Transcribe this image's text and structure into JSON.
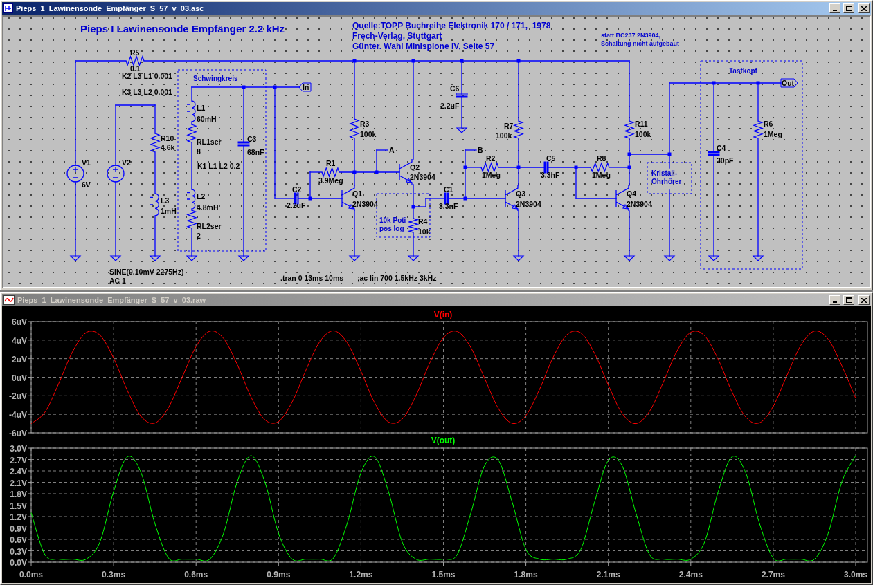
{
  "schematic_window": {
    "title": "Pieps_1_Lawinensonde_Empfänger_S_57_v_03.asc",
    "active": true
  },
  "schematic": {
    "heading": "Pieps I Lawinensonde Empfänger 2.2 kHz",
    "source_lines": [
      "Quelle:TOPP Buchreihe Elektronik 170 / 171,  1978",
      "Frech-Verlag, Stuttgart",
      "Günter. Wahl Minispione IV, Seite 57"
    ],
    "notes": [
      {
        "lines": [
          "statt BC237 2N3904,",
          "Schaltung nicht aufgebaut"
        ]
      },
      {
        "lines": [
          "Schwingkreis"
        ]
      },
      {
        "lines": [
          "10k Poti",
          "pos log"
        ]
      },
      {
        "lines": [
          "Kristall-",
          "Ohrhörer"
        ]
      },
      {
        "lines": [
          "Tastkopf"
        ]
      }
    ],
    "components": [
      {
        "kind": "resistor",
        "name": "R5",
        "value": "0.1"
      },
      {
        "kind": "source",
        "name": "V1",
        "value": "6V"
      },
      {
        "kind": "source",
        "name": "V2",
        "value": "SINE(0.10mV 2275Hz)",
        "extra": "AC 1"
      },
      {
        "kind": "resistor",
        "name": "R10",
        "value": "4.6k"
      },
      {
        "kind": "inductor",
        "name": "L3",
        "value": "1mH"
      },
      {
        "kind": "inductor",
        "name": "L1",
        "value": "60mH"
      },
      {
        "kind": "resistor",
        "name": "RL1ser",
        "value": "8"
      },
      {
        "kind": "inductor",
        "name": "L2",
        "value": "4.8mH"
      },
      {
        "kind": "resistor",
        "name": "RL2ser",
        "value": "2"
      },
      {
        "kind": "capacitor",
        "name": "C3",
        "value": "68nF"
      },
      {
        "kind": "polar_capacitor",
        "name": "C2",
        "value": "2.2uF"
      },
      {
        "kind": "resistor",
        "name": "R1",
        "value": "3.9Meg"
      },
      {
        "kind": "resistor",
        "name": "R3",
        "value": "100k"
      },
      {
        "kind": "npn",
        "name": "Q1",
        "value": "2N3904"
      },
      {
        "kind": "npn",
        "name": "Q2",
        "value": "2N3904"
      },
      {
        "kind": "resistor",
        "name": "R4",
        "value": "10k"
      },
      {
        "kind": "polar_capacitor",
        "name": "C6",
        "value": "2.2uF"
      },
      {
        "kind": "capacitor",
        "name": "C1",
        "value": "3.3nF"
      },
      {
        "kind": "resistor",
        "name": "R2",
        "value": "1Meg"
      },
      {
        "kind": "resistor",
        "name": "R7",
        "value": "100k"
      },
      {
        "kind": "npn",
        "name": "Q3",
        "value": "2N3904"
      },
      {
        "kind": "capacitor",
        "name": "C5",
        "value": "3.3nF"
      },
      {
        "kind": "resistor",
        "name": "R8",
        "value": "1Meg"
      },
      {
        "kind": "resistor",
        "name": "R11",
        "value": "100k"
      },
      {
        "kind": "npn",
        "name": "Q4",
        "value": "2N3904"
      },
      {
        "kind": "capacitor",
        "name": "C4",
        "value": "30pF"
      },
      {
        "kind": "resistor",
        "name": "R6",
        "value": "1Meg"
      }
    ],
    "net_labels": [
      {
        "kind": "port",
        "text": "In"
      },
      {
        "kind": "net",
        "text": "A"
      },
      {
        "kind": "net",
        "text": "B"
      },
      {
        "kind": "port",
        "text": "Out"
      }
    ],
    "directives": [
      "K2 L3 L1 0.001",
      "K3 L3 L2 0.001",
      "K1 L1 L2 0.2",
      ".tran 0 13ms 10ms",
      ";ac lin 700 1.5kHz 3kHz"
    ]
  },
  "plot_window": {
    "title": "Pieps_1_Lawinensonde_Empfänger_S_57_v_03.raw",
    "active": false
  },
  "plot": {
    "charts": [
      {
        "chart_data": {
          "type": "line",
          "x": [
            0,
            0.05,
            0.1,
            0.15,
            0.2,
            0.25,
            0.3,
            0.35,
            0.4,
            0.45,
            0.5,
            0.55,
            0.6,
            0.65,
            0.7,
            0.75,
            0.8,
            0.85,
            0.9,
            0.95,
            1,
            1.05,
            1.1,
            1.15,
            1.2,
            1.25,
            1.3,
            1.35,
            1.4,
            1.45,
            1.5,
            1.55,
            1.6,
            1.65,
            1.7,
            1.75,
            1.8,
            1.85,
            1.9,
            1.95,
            2,
            2.05,
            2.1,
            2.15,
            2.2,
            2.25,
            2.3,
            2.35,
            2.4,
            2.45,
            2.5,
            2.55,
            2.6,
            2.65,
            2.7,
            2.75,
            2.8,
            2.85,
            2.9,
            2.95,
            3
          ],
          "series": [
            {
              "name": "V(in)",
              "color": "#ff0000",
              "values": [
                -5.0,
                -3.78,
                -0.7,
                2.71,
                4.8,
                4.54,
                2.06,
                -1.43,
                -4.22,
                -4.94,
                -3.25,
                0.04,
                3.31,
                4.96,
                4.18,
                1.36,
                -2.13,
                -4.57,
                -4.78,
                -2.65,
                0.78,
                3.83,
                5.0,
                3.72,
                0.63,
                -2.78,
                -4.82,
                -4.51,
                -1.99,
                1.51,
                4.26,
                4.93,
                3.19,
                -0.12,
                -3.37,
                -4.97,
                -4.14,
                -1.28,
                2.2,
                4.6,
                4.76,
                2.58,
                -0.86,
                -3.88,
                -5.0,
                -3.67,
                -0.55,
                2.84,
                4.84,
                4.47,
                1.91,
                -1.58,
                -4.3,
                -4.92,
                -3.13,
                0.2,
                3.42,
                4.97,
                4.09,
                1.21,
                -2.27
              ]
            }
          ],
          "xlim": [
            0,
            3
          ],
          "ylim": [
            -6,
            6
          ],
          "grid": true,
          "yticks": [
            {
              "value": 6,
              "label": "6uV"
            },
            {
              "value": 4,
              "label": "4uV"
            },
            {
              "value": 2,
              "label": "2uV"
            },
            {
              "value": 0,
              "label": "0uV"
            },
            {
              "value": -2,
              "label": "-2uV"
            },
            {
              "value": -4,
              "label": "-4uV"
            },
            {
              "value": -6,
              "label": "-6uV"
            }
          ]
        }
      },
      {
        "chart_data": {
          "type": "line",
          "x": [
            0,
            0.05,
            0.1,
            0.15,
            0.2,
            0.25,
            0.3,
            0.35,
            0.4,
            0.45,
            0.5,
            0.55,
            0.6,
            0.65,
            0.7,
            0.75,
            0.8,
            0.85,
            0.9,
            0.95,
            1,
            1.05,
            1.1,
            1.15,
            1.2,
            1.25,
            1.3,
            1.35,
            1.4,
            1.45,
            1.5,
            1.55,
            1.6,
            1.65,
            1.7,
            1.75,
            1.8,
            1.85,
            1.9,
            1.95,
            2,
            2.05,
            2.1,
            2.15,
            2.2,
            2.25,
            2.3,
            2.35,
            2.4,
            2.45,
            2.5,
            2.55,
            2.6,
            2.65,
            2.7,
            2.75,
            2.8,
            2.85,
            2.9,
            2.95,
            3
          ],
          "series": [
            {
              "name": "V(out)",
              "color": "#00ff00",
              "values": [
                1.3,
                0.2,
                0.08,
                0.08,
                0.08,
                0.53,
                1.86,
                2.77,
                2.35,
                1.02,
                0.11,
                0.08,
                0.08,
                0.08,
                0.76,
                2.12,
                2.8,
                2.12,
                0.76,
                0.08,
                0.08,
                0.08,
                0.11,
                1.02,
                2.35,
                2.77,
                1.86,
                0.53,
                0.08,
                0.08,
                0.08,
                0.2,
                1.3,
                2.54,
                2.68,
                1.58,
                0.34,
                0.08,
                0.08,
                0.08,
                0.34,
                1.58,
                2.68,
                2.54,
                1.3,
                0.2,
                0.08,
                0.08,
                0.08,
                0.53,
                1.86,
                2.77,
                2.35,
                1.02,
                0.11,
                0.08,
                0.08,
                0.08,
                0.76,
                2.12,
                2.8
              ]
            }
          ],
          "xlim": [
            0,
            3
          ],
          "ylim": [
            0,
            3
          ],
          "grid": true,
          "xticks": [
            {
              "value": 0,
              "label": "0.0ms"
            },
            {
              "value": 0.3,
              "label": "0.3ms"
            },
            {
              "value": 0.6,
              "label": "0.6ms"
            },
            {
              "value": 0.9,
              "label": "0.9ms"
            },
            {
              "value": 1.2,
              "label": "1.2ms"
            },
            {
              "value": 1.5,
              "label": "1.5ms"
            },
            {
              "value": 1.8,
              "label": "1.8ms"
            },
            {
              "value": 2.1,
              "label": "2.1ms"
            },
            {
              "value": 2.4,
              "label": "2.4ms"
            },
            {
              "value": 2.7,
              "label": "2.7ms"
            },
            {
              "value": 3.0,
              "label": "3.0ms"
            }
          ],
          "yticks": [
            {
              "value": 3.0,
              "label": "3.0V"
            },
            {
              "value": 2.7,
              "label": "2.7V"
            },
            {
              "value": 2.4,
              "label": "2.4V"
            },
            {
              "value": 2.1,
              "label": "2.1V"
            },
            {
              "value": 1.8,
              "label": "1.8V"
            },
            {
              "value": 1.5,
              "label": "1.5V"
            },
            {
              "value": 1.2,
              "label": "1.2V"
            },
            {
              "value": 0.9,
              "label": "0.9V"
            },
            {
              "value": 0.6,
              "label": "0.6V"
            },
            {
              "value": 0.3,
              "label": "0.3V"
            },
            {
              "value": 0.0,
              "label": "0.0V"
            }
          ]
        }
      }
    ]
  }
}
